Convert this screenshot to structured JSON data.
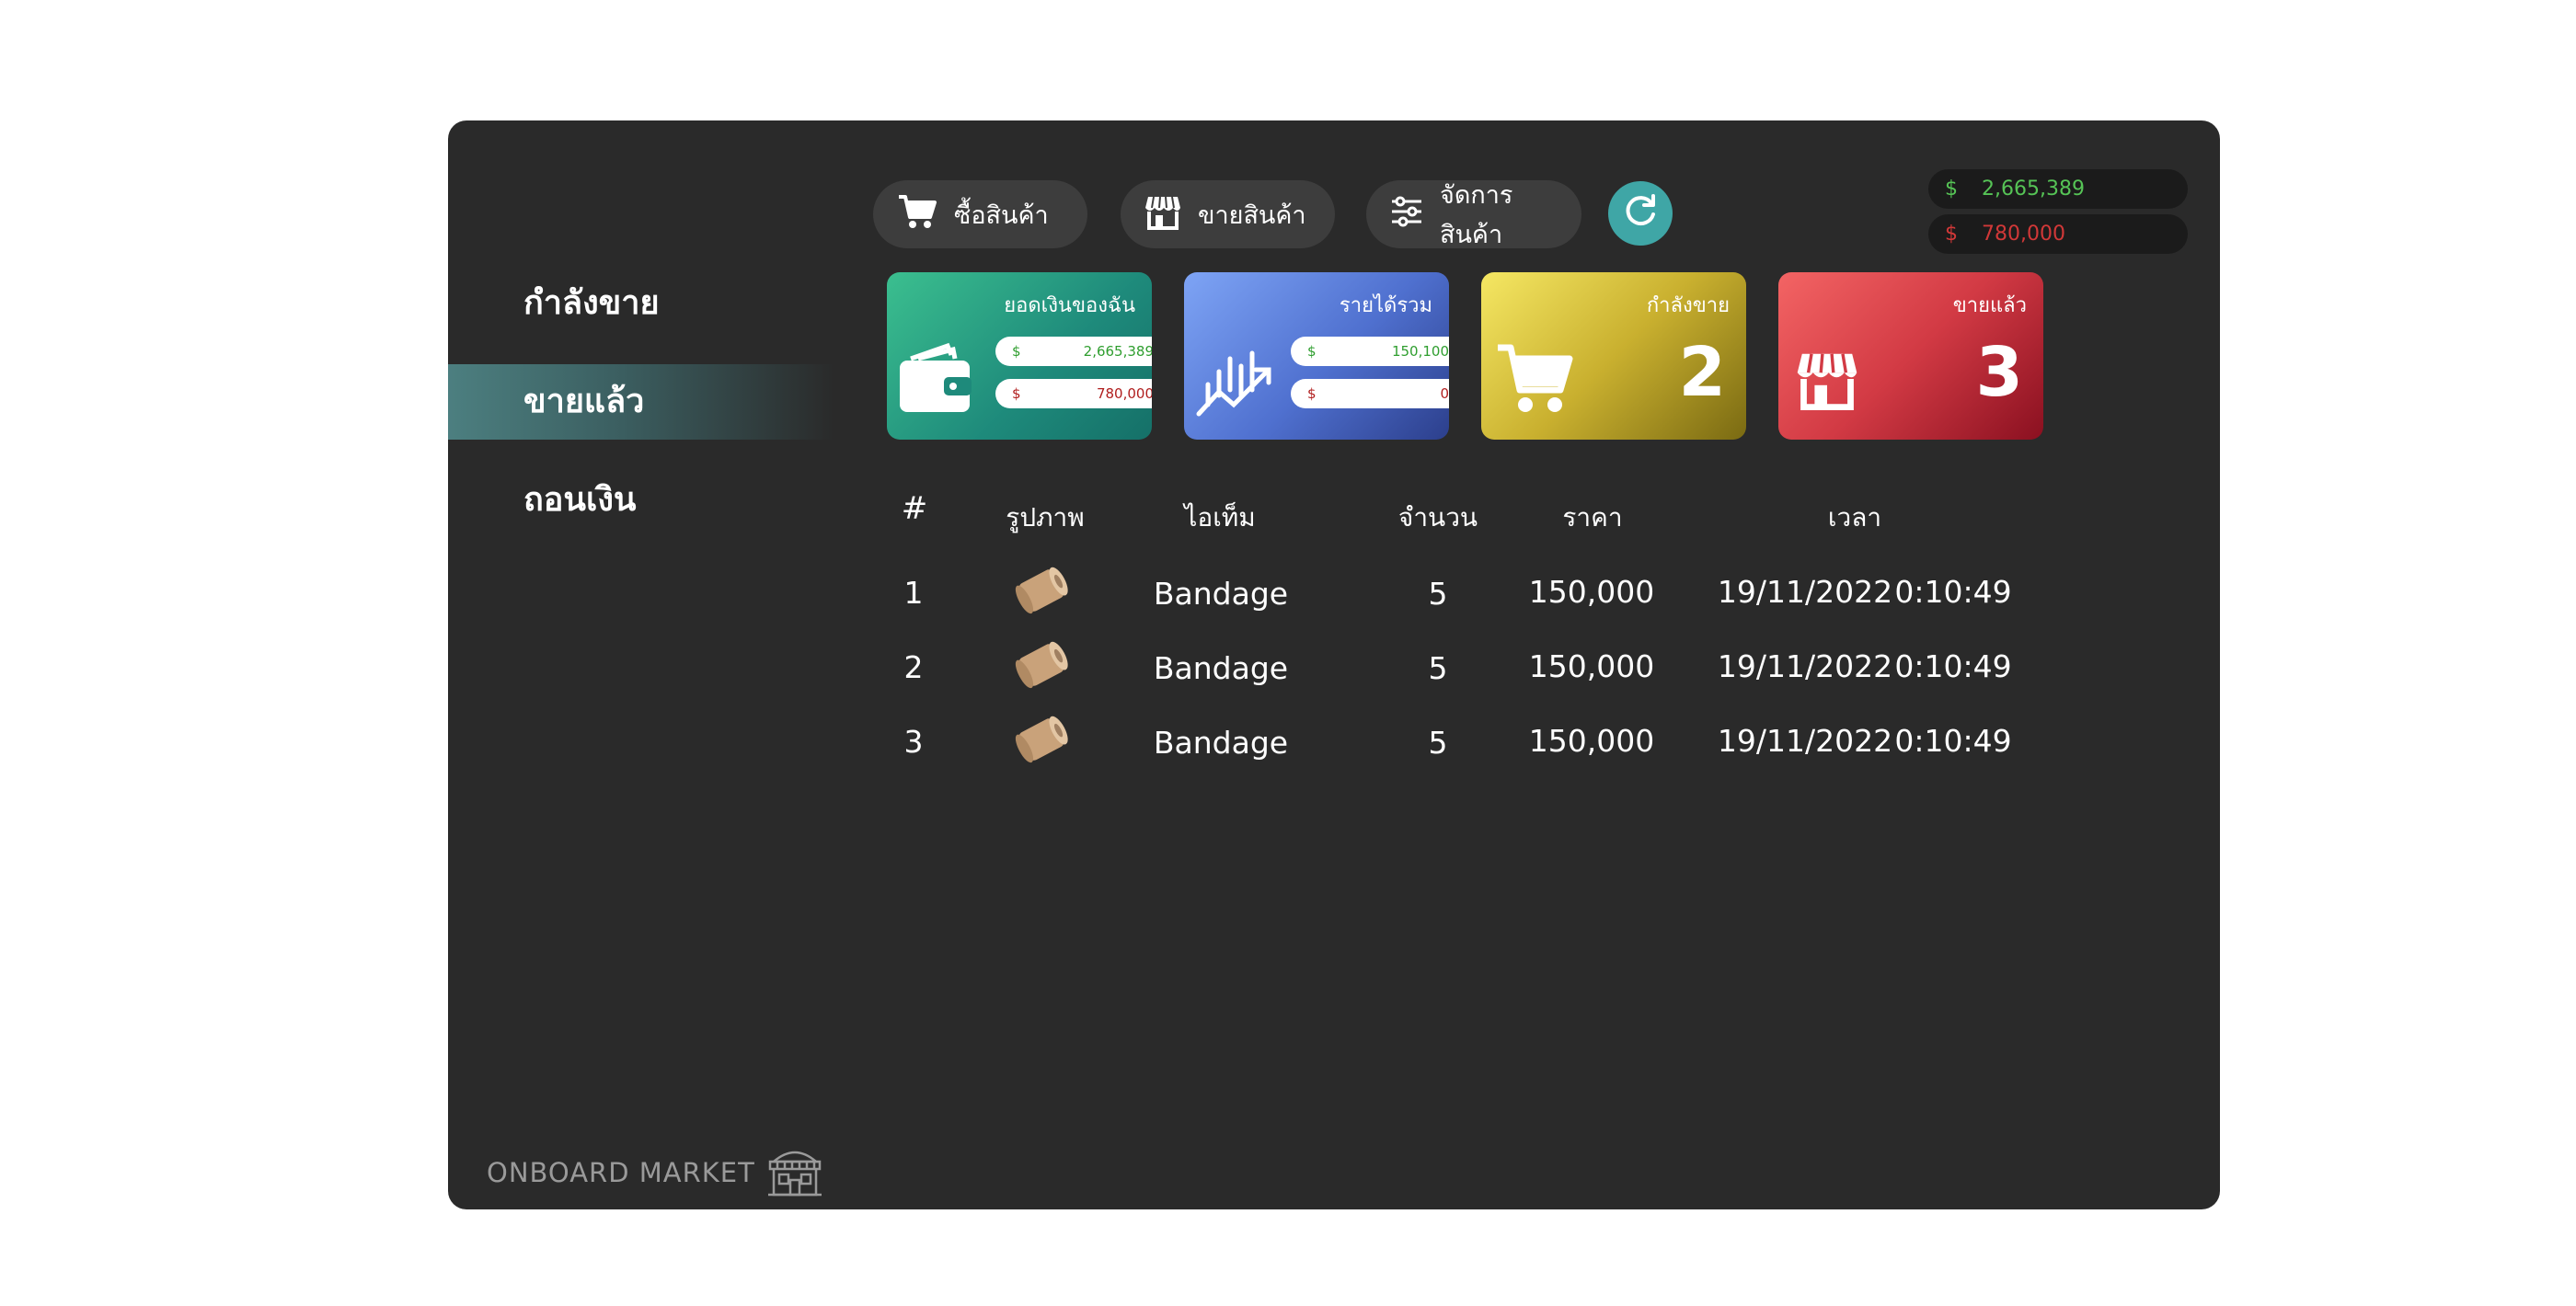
{
  "sidebar": {
    "items": [
      {
        "label": "กำลังขาย"
      },
      {
        "label": "ขายแล้ว"
      },
      {
        "label": "ถอนเงิน"
      }
    ],
    "active_index": 1
  },
  "brand": {
    "name": "ONBOARD MARKET",
    "icon": "store-building-icon"
  },
  "toolbar": {
    "buy_label": "ซื้อสินค้า",
    "sell_label": "ขายสินค้า",
    "manage_label": "จัดการสินค้า",
    "refresh_icon": "refresh-icon"
  },
  "balances": {
    "currency": "$",
    "positive": "2,665,389",
    "negative": "780,000"
  },
  "cards": {
    "wallet": {
      "title": "ยอดเงินของฉัน",
      "positive": "2,665,389",
      "negative": "780,000",
      "currency": "$"
    },
    "income": {
      "title": "รายได้รวม",
      "positive": "150,100",
      "negative": "0",
      "currency": "$"
    },
    "selling": {
      "title": "กำลังขาย",
      "count": "2"
    },
    "sold": {
      "title": "ขายแล้ว",
      "count": "3"
    }
  },
  "table": {
    "headers": {
      "index": "#",
      "image": "รูปภาพ",
      "item": "ไอเท็ม",
      "qty": "จำนวน",
      "price": "ราคา",
      "time": "เวลา"
    },
    "rows": [
      {
        "index": "1",
        "item": "Bandage",
        "qty": "5",
        "price": "150,000",
        "date": "19/11/2022",
        "time": "0:10:49"
      },
      {
        "index": "2",
        "item": "Bandage",
        "qty": "5",
        "price": "150,000",
        "date": "19/11/2022",
        "time": "0:10:49"
      },
      {
        "index": "3",
        "item": "Bandage",
        "qty": "5",
        "price": "150,000",
        "date": "19/11/2022",
        "time": "0:10:49"
      }
    ]
  },
  "colors": {
    "panel_bg": "#2a2a2a",
    "accent_teal": "#3fa6a6",
    "positive": "#56c456",
    "negative": "#d13838"
  }
}
